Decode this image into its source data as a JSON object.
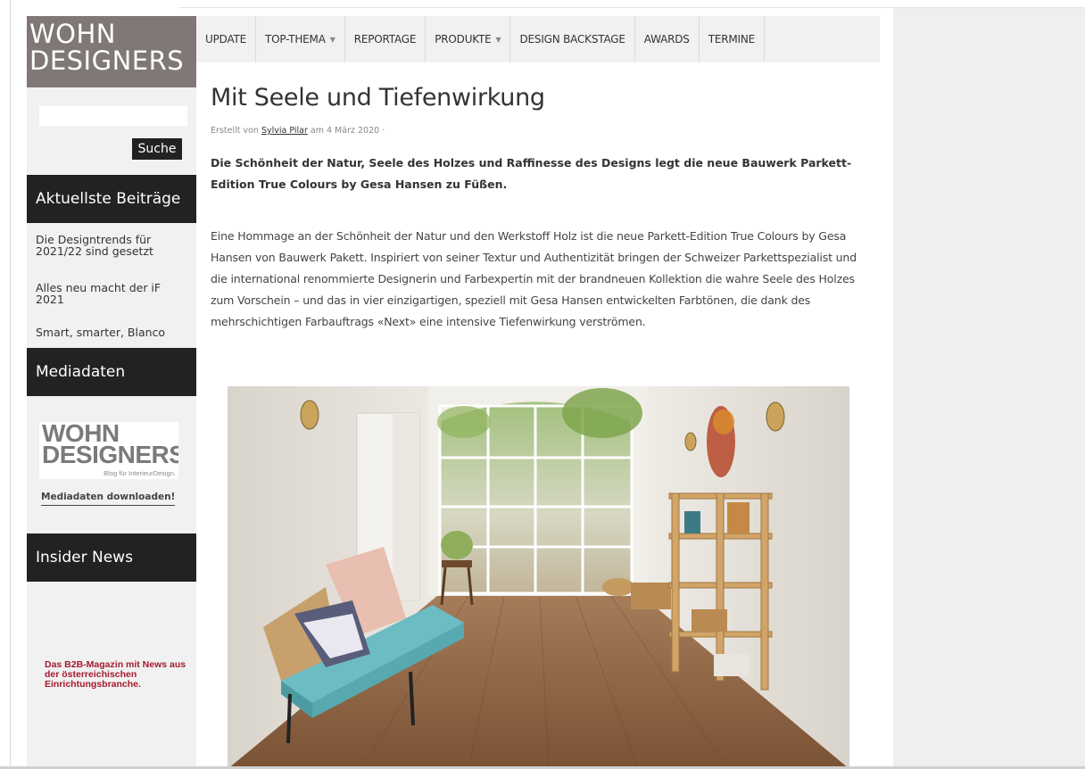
{
  "site": {
    "logo_line1": "WOHN",
    "logo_line2": "DESIGNERS"
  },
  "search": {
    "placeholder": "",
    "button_label": "Suche"
  },
  "nav": {
    "items": [
      {
        "label": "UPDATE",
        "dropdown": false
      },
      {
        "label": "TOP-THEMA",
        "dropdown": true
      },
      {
        "label": "REPORTAGE",
        "dropdown": false
      },
      {
        "label": "PRODUKTE",
        "dropdown": true
      },
      {
        "label": "DESIGN BACKSTAGE",
        "dropdown": false
      },
      {
        "label": "AWARDS",
        "dropdown": false
      },
      {
        "label": "TERMINE",
        "dropdown": false
      }
    ]
  },
  "sidebar": {
    "recent_title": "Aktuellste Beiträge",
    "recent_posts": [
      "Die Designtrends für 2021/22 sind gesetzt",
      "Alles neu macht der iF 2021",
      "Smart, smarter, Blanco"
    ],
    "media_title": "Mediadaten",
    "media_logo_line1": "WOHN",
    "media_logo_line2": "DESIGNERS",
    "media_logo_tagline": "Blog für InterieurDesign.",
    "media_download_label": "Mediadaten downloaden!",
    "insider_title": "Insider News",
    "ad_text": "Das B2B-Magazin mit News aus der österreichischen Einrichtungsbranche."
  },
  "article": {
    "title": "Mit Seele und Tiefenwirkung",
    "meta_prefix": "Erstellt von",
    "author": "Sylvia Pilar",
    "meta_date": "am 4 März 2020 ·",
    "lead": "Die Schönheit der Natur, Seele des Holzes und Raffinesse des Designs legt die neue Bauwerk Parkett-Edition True Colours by Gesa Hansen zu Füßen.",
    "body": "Eine Hommage an der Schönheit der Natur und den Werkstoff Holz ist die neue Parkett-Edition True Colours by Gesa Hansen von Bauwerk Pakett. Inspiriert von seiner Textur und Authentizität bringen der Schweizer Parkettspezialist und die international renommierte Designerin und Farbexpertin mit der brandneuen Kollektion die wahre Seele des Holzes zum Vorschein – und das in vier einzigartigen, speziell mit Gesa Hansen entwickelten Farbtönen, die dank des mehrschichtigen Farbauftrags «Next» eine intensive Tiefenwirkung verströmen."
  },
  "colors": {
    "logo_bg": "#7f7874",
    "widget_bg": "#222222",
    "sidebar_bg": "#f1f1f1",
    "nav_bg": "#f1f1f1",
    "ad_red": "#a6192e",
    "right_bg": "#efefef"
  }
}
